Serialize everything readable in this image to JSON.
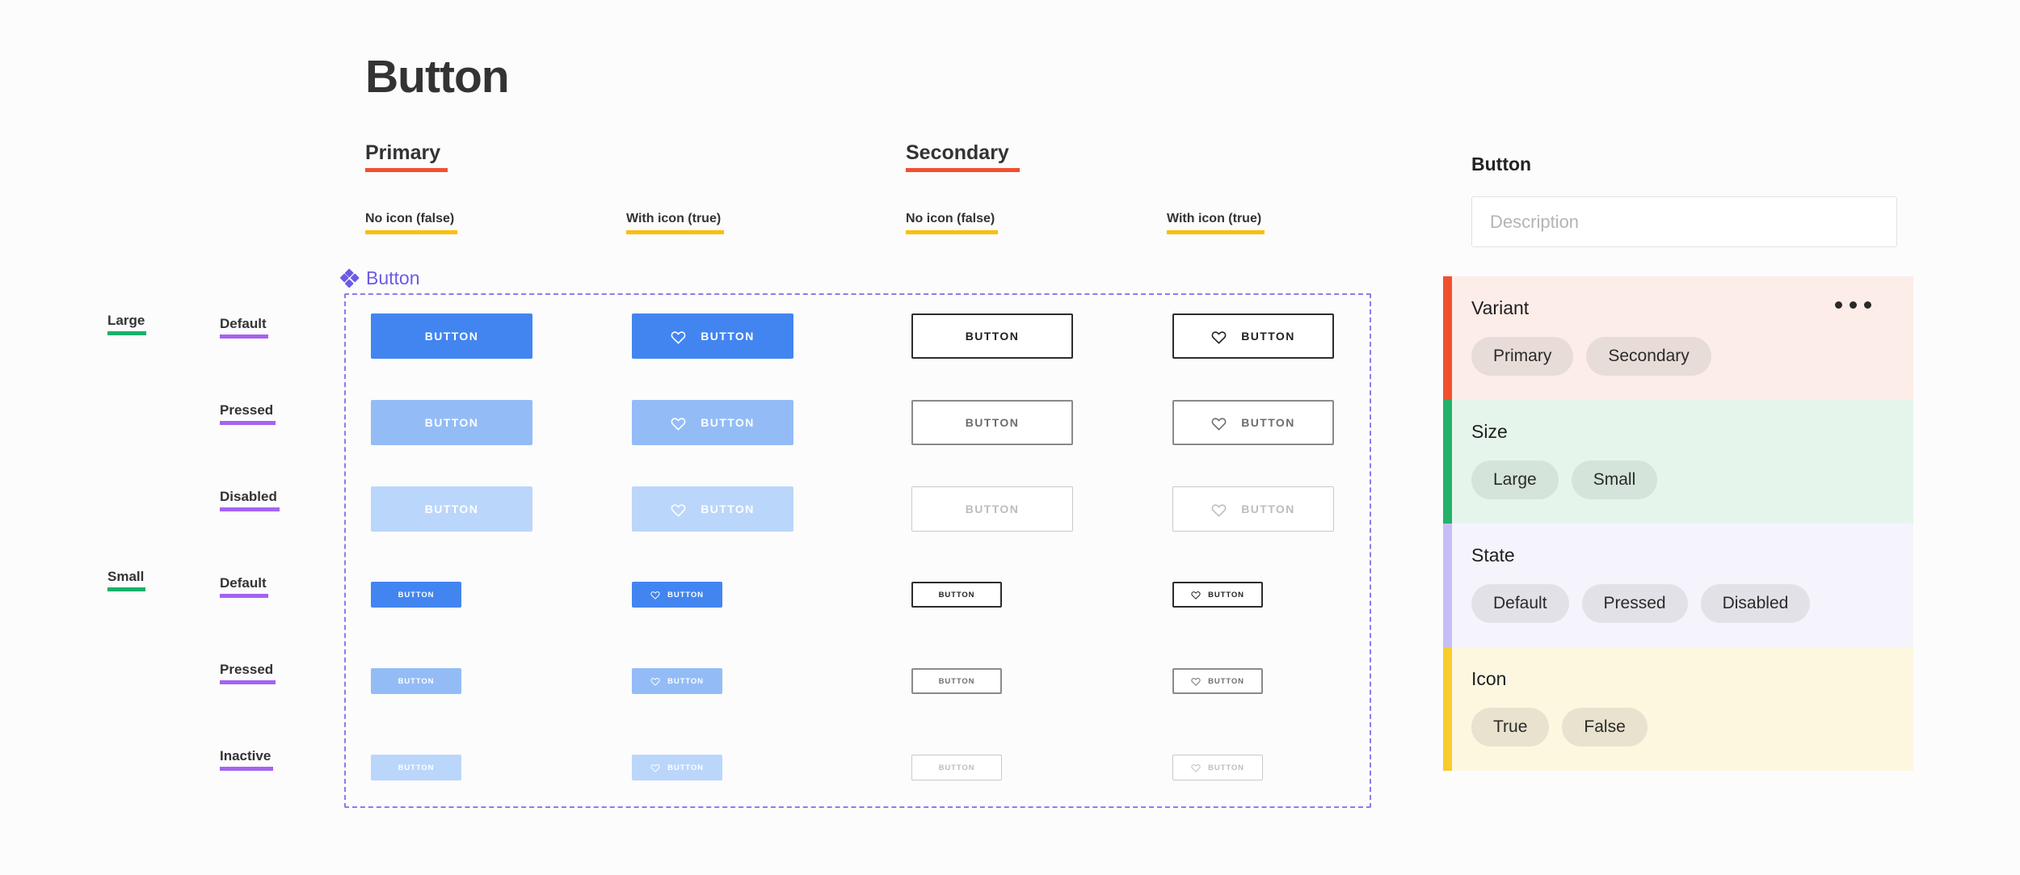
{
  "page": {
    "title": "Button"
  },
  "variant_groups": [
    {
      "label": "Primary",
      "rule_color": "#F1502F"
    },
    {
      "label": "Secondary",
      "rule_color": "#F1502F"
    }
  ],
  "column_headers": [
    {
      "label": "No icon (false)",
      "rule_color": "#FBBE0A"
    },
    {
      "label": "With icon (true)",
      "rule_color": "#FBBE0A"
    },
    {
      "label": "No icon (false)",
      "rule_color": "#FBBE0A"
    },
    {
      "label": "With icon (true)",
      "rule_color": "#FBBE0A"
    }
  ],
  "component": {
    "label": "Button",
    "label_color": "#6B5BE6",
    "frame_border_color": "#8D7BF0",
    "icon": "component-diamond-icon"
  },
  "size_labels": [
    {
      "label": "Large",
      "rule_color": "#19B06A"
    },
    {
      "label": "Small",
      "rule_color": "#19B06A"
    }
  ],
  "state_labels": [
    {
      "label": "Default",
      "rule_color": "#A463F2"
    },
    {
      "label": "Pressed",
      "rule_color": "#A463F2"
    },
    {
      "label": "Disabled",
      "rule_color": "#A463F2"
    },
    {
      "label": "Default",
      "rule_color": "#A463F2"
    },
    {
      "label": "Pressed",
      "rule_color": "#A463F2"
    },
    {
      "label": "Inactive",
      "rule_color": "#A463F2"
    }
  ],
  "button_label": "BUTTON",
  "button_grid": {
    "columns": [
      {
        "variant": "primary",
        "icon": false
      },
      {
        "variant": "primary",
        "icon": true
      },
      {
        "variant": "secondary",
        "icon": false
      },
      {
        "variant": "secondary",
        "icon": true
      }
    ],
    "rows": [
      {
        "size": "large",
        "state": "default"
      },
      {
        "size": "large",
        "state": "pressed"
      },
      {
        "size": "large",
        "state": "disabled"
      },
      {
        "size": "small",
        "state": "default"
      },
      {
        "size": "small",
        "state": "pressed"
      },
      {
        "size": "small",
        "state": "disabled"
      }
    ],
    "cells": [
      {
        "label": "BUTTON",
        "variant": "primary",
        "state": "default",
        "size": "large",
        "icon": false
      },
      {
        "label": "BUTTON",
        "variant": "primary",
        "state": "default",
        "size": "large",
        "icon": true
      },
      {
        "label": "BUTTON",
        "variant": "secondary",
        "state": "default",
        "size": "large",
        "icon": false
      },
      {
        "label": "BUTTON",
        "variant": "secondary",
        "state": "default",
        "size": "large",
        "icon": true
      },
      {
        "label": "BUTTON",
        "variant": "primary",
        "state": "pressed",
        "size": "large",
        "icon": false
      },
      {
        "label": "BUTTON",
        "variant": "primary",
        "state": "pressed",
        "size": "large",
        "icon": true
      },
      {
        "label": "BUTTON",
        "variant": "secondary",
        "state": "pressed",
        "size": "large",
        "icon": false
      },
      {
        "label": "BUTTON",
        "variant": "secondary",
        "state": "pressed",
        "size": "large",
        "icon": true
      },
      {
        "label": "BUTTON",
        "variant": "primary",
        "state": "disabled",
        "size": "large",
        "icon": false
      },
      {
        "label": "BUTTON",
        "variant": "primary",
        "state": "disabled",
        "size": "large",
        "icon": true
      },
      {
        "label": "BUTTON",
        "variant": "secondary",
        "state": "disabled",
        "size": "large",
        "icon": false
      },
      {
        "label": "BUTTON",
        "variant": "secondary",
        "state": "disabled",
        "size": "large",
        "icon": true
      },
      {
        "label": "BUTTON",
        "variant": "primary",
        "state": "default",
        "size": "small",
        "icon": false
      },
      {
        "label": "BUTTON",
        "variant": "primary",
        "state": "default",
        "size": "small",
        "icon": true
      },
      {
        "label": "BUTTON",
        "variant": "secondary",
        "state": "default",
        "size": "small",
        "icon": false
      },
      {
        "label": "BUTTON",
        "variant": "secondary",
        "state": "default",
        "size": "small",
        "icon": true
      },
      {
        "label": "BUTTON",
        "variant": "primary",
        "state": "pressed",
        "size": "small",
        "icon": false
      },
      {
        "label": "BUTTON",
        "variant": "primary",
        "state": "pressed",
        "size": "small",
        "icon": true
      },
      {
        "label": "BUTTON",
        "variant": "secondary",
        "state": "pressed",
        "size": "small",
        "icon": false
      },
      {
        "label": "BUTTON",
        "variant": "secondary",
        "state": "pressed",
        "size": "small",
        "icon": true
      },
      {
        "label": "BUTTON",
        "variant": "primary",
        "state": "disabled",
        "size": "small",
        "icon": false
      },
      {
        "label": "BUTTON",
        "variant": "primary",
        "state": "disabled",
        "size": "small",
        "icon": true
      },
      {
        "label": "BUTTON",
        "variant": "secondary",
        "state": "disabled",
        "size": "small",
        "icon": false
      },
      {
        "label": "BUTTON",
        "variant": "secondary",
        "state": "disabled",
        "size": "small",
        "icon": true
      }
    ]
  },
  "colors": {
    "primary_default": "#4285F0",
    "primary_pressed": "#93BCF7",
    "primary_disabled": "#BBD6FB",
    "secondary_default_border": "#2C2C2C",
    "secondary_pressed_border": "#8A8A8A",
    "secondary_disabled_border": "#C9C9C9",
    "canvas": "#FCFCFC"
  },
  "inspector": {
    "title": "Button",
    "description": {
      "value": "",
      "placeholder": "Description"
    },
    "sections": [
      {
        "name": "Variant",
        "accent": "#F1502F",
        "background": "#FDEDE8",
        "chip_background": "#E8DCD8",
        "has_menu": true,
        "menu_icon": "more-horizontal-icon",
        "chips": [
          "Primary",
          "Secondary"
        ]
      },
      {
        "name": "Size",
        "accent": "#23B26B",
        "background": "#E6F5EC",
        "chip_background": "#D4E4DA",
        "has_menu": false,
        "chips": [
          "Large",
          "Small"
        ]
      },
      {
        "name": "State",
        "accent": "#C6BDF5",
        "background": "#F5F4FC",
        "chip_background": "#E3E1E8",
        "has_menu": false,
        "chips": [
          "Default",
          "Pressed",
          "Disabled"
        ]
      },
      {
        "name": "Icon",
        "accent": "#F8CC2B",
        "background": "#FDF7E0",
        "chip_background": "#E8E2CE",
        "has_menu": false,
        "chips": [
          "True",
          "False"
        ]
      }
    ]
  }
}
